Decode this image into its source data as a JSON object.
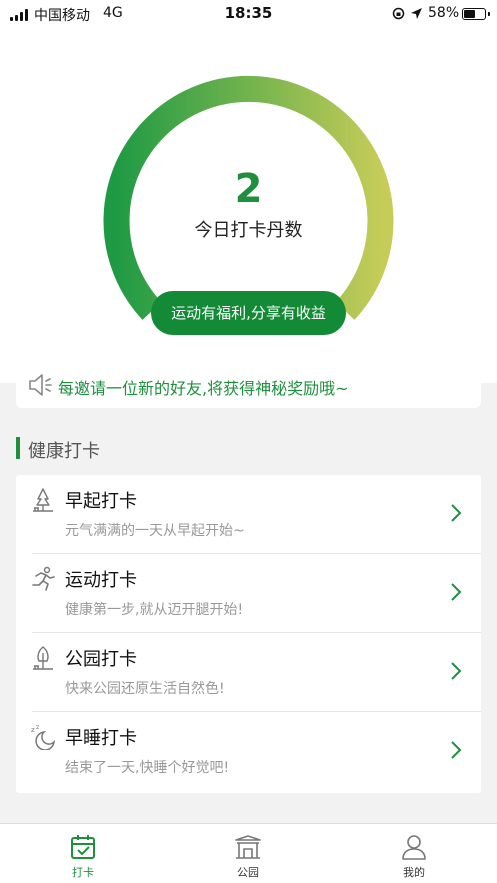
{
  "status_bar": {
    "carrier": "中国移动",
    "network": "4G",
    "time": "18:35",
    "battery": "58%",
    "battery_level": 0.58
  },
  "hero": {
    "count": "2",
    "count_label": "今日打卡丹数",
    "share_button": "运动有福利,分享有收益"
  },
  "notice": {
    "text": "每邀请一位新的好友,将获得神秘奖励哦~",
    "icon": "speaker-icon"
  },
  "section": {
    "title": "健康打卡"
  },
  "checkins": [
    {
      "title": "早起打卡",
      "subtitle": "元气满满的一天从早起开始~",
      "icon": "tree-bench-icon"
    },
    {
      "title": "运动打卡",
      "subtitle": "健康第一步,就从迈开腿开始!",
      "icon": "runner-icon"
    },
    {
      "title": "公园打卡",
      "subtitle": "快来公园还原生活自然色!",
      "icon": "park-tree-icon"
    },
    {
      "title": "早睡打卡",
      "subtitle": "结束了一天,快睡个好觉吧!",
      "icon": "moon-sleep-icon"
    }
  ],
  "tabs": [
    {
      "label": "打卡",
      "icon": "calendar-check-icon",
      "active": true
    },
    {
      "label": "公园",
      "icon": "park-gate-icon",
      "active": false
    },
    {
      "label": "我的",
      "icon": "user-icon",
      "active": false
    }
  ],
  "colors": {
    "accent": "#1f8f3e",
    "gauge_start": "#1f9a44",
    "gauge_end": "#c5cc58",
    "muted": "#999999"
  }
}
